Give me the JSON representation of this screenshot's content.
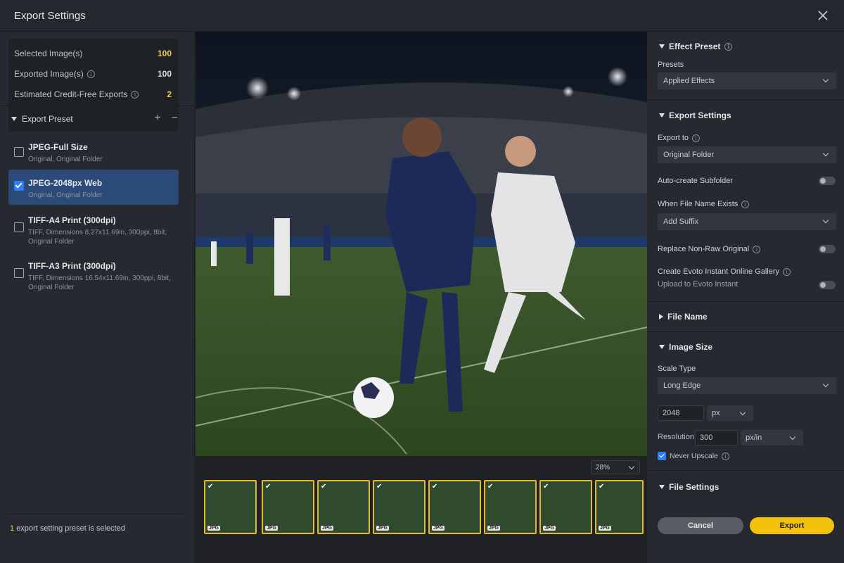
{
  "window": {
    "title": "Export Settings"
  },
  "stats": {
    "selected_label": "Selected Image(s)",
    "selected_value": "100",
    "exported_label": "Exported Image(s)",
    "exported_value": "100",
    "credit_free_label": "Estimated Credit-Free Exports",
    "credit_free_value": "2"
  },
  "export_preset": {
    "header": "Export Preset",
    "items": [
      {
        "name": "JPEG-Full Size",
        "sub": "Original, Original Folder",
        "checked": false
      },
      {
        "name": "JPEG-2048px Web",
        "sub": "Original, Original Folder",
        "checked": true
      },
      {
        "name": "TIFF-A4 Print (300dpi)",
        "sub": "TIFF, Dimensions 8.27x11.69in, 300ppi, 8bit, Original Folder",
        "checked": false
      },
      {
        "name": "TIFF-A3 Print (300dpi)",
        "sub": "TIFF, Dimensions 16.54x11.69in, 300ppi, 8bit, Original Folder",
        "checked": false
      }
    ],
    "footer_count": "1",
    "footer_text": "export setting preset is selected"
  },
  "preview": {
    "zoom": "28%",
    "thumb_badge": "JPG",
    "thumb_count": 8
  },
  "effect_preset": {
    "header": "Effect Preset",
    "presets_label": "Presets",
    "presets_value": "Applied Effects"
  },
  "export_settings": {
    "header": "Export Settings",
    "export_to_label": "Export to",
    "export_to_value": "Original Folder",
    "auto_subfolder_label": "Auto-create Subfolder",
    "file_exists_label": "When File Name Exists",
    "file_exists_value": "Add Suffix",
    "replace_label": "Replace Non-Raw Original",
    "gallery_label": "Create Evoto Instant Online Gallery",
    "gallery_sub": "Upload to Evoto Instant"
  },
  "file_name": {
    "header": "File Name"
  },
  "image_size": {
    "header": "Image Size",
    "scale_type_label": "Scale Type",
    "scale_type_value": "Long Edge",
    "size_value": "2048",
    "size_unit": "px",
    "resolution_label": "Resolution",
    "resolution_value": "300",
    "resolution_unit": "px/in",
    "never_upscale_label": "Never Upscale"
  },
  "file_settings": {
    "header": "File Settings"
  },
  "actions": {
    "cancel": "Cancel",
    "export": "Export"
  },
  "colors": {
    "accent": "#f4c20d",
    "selected": "#2c4a78",
    "checkbox": "#2d7ff9"
  }
}
